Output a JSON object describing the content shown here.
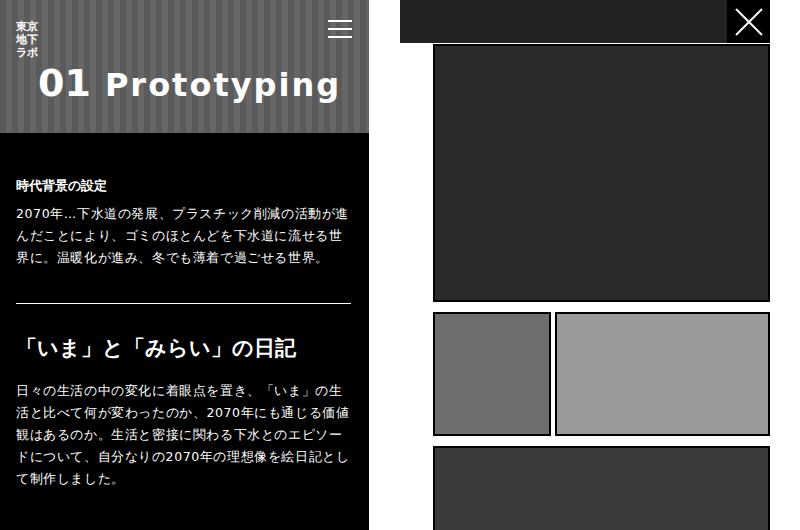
{
  "header": {
    "logo": [
      "東京",
      "地下",
      "ラボ"
    ]
  },
  "section": {
    "number": "01",
    "title": "Prototyping"
  },
  "blocks": [
    {
      "kind": "small",
      "heading": "時代背景の設定",
      "body": "2070年…下水道の発展、プラスチック削減の活動が進んだことにより、ゴミのほとんどを下水道に流せる世界に。温暖化が進み、冬でも薄着で過ごせる世界。"
    },
    {
      "kind": "large",
      "heading": "「いま」と「みらい」の日記",
      "body": "日々の生活の中の変化に着眼点を置き、「いま」の生活と比べて何が変わったのか、2070年にも通じる価値観はあるのか。生活と密接に関わる下水とのエピソードについて、自分なりの2070年の理想像を絵日記として制作しました。"
    }
  ]
}
